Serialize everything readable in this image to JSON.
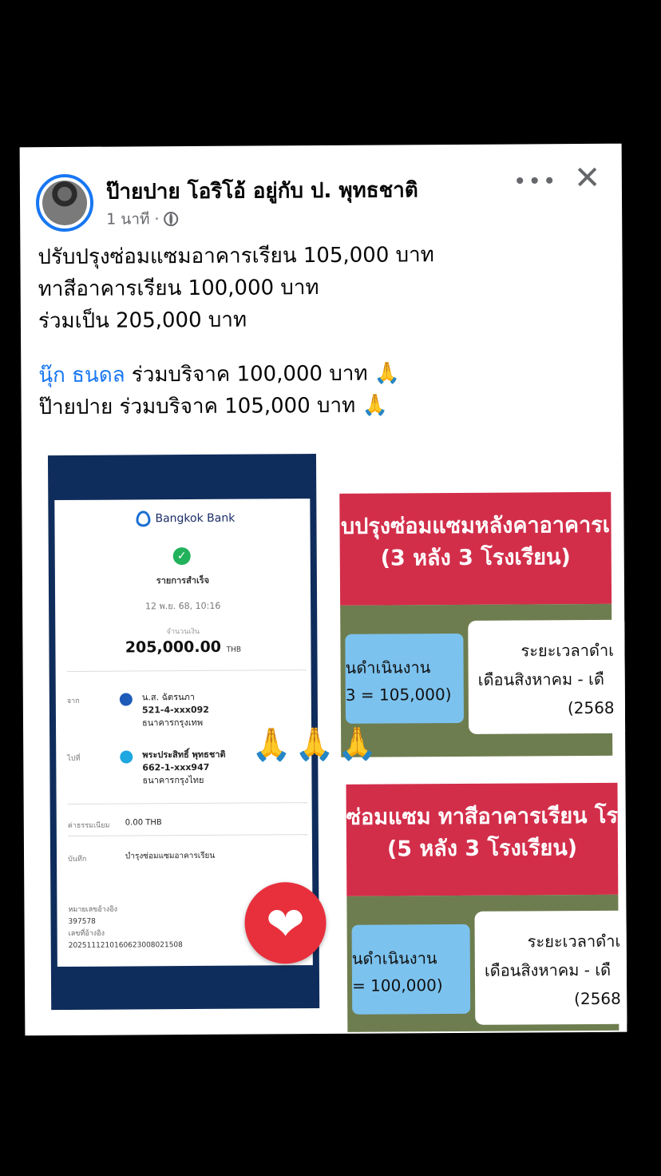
{
  "post": {
    "author": "ป๊ายปาย โอริโอ้ อยู่กับ ป. พุทธชาติ",
    "time": "1 นาที",
    "more_icon": "•••",
    "close_icon": "✕",
    "lines": [
      "ปรับปรุงซ่อมแซมอาคารเรียน 105,000 บาท",
      "ทาสีอาคารเรียน  100,000 บาท",
      "ร่วมเป็น 205,000 บาท"
    ],
    "mention": "นุ๊ก ธนดล",
    "donate1_text": " ร่วมบริจาค 100,000 บาท ",
    "donate2_text": "ป๊ายปาย ร่วมบริจาค 105,000 บาท ",
    "pray_emoji": "🙏"
  },
  "receipt": {
    "bank": "Bangkok Bank",
    "status": "รายการสำเร็จ",
    "datetime": "12 พ.ย. 68, 10:16",
    "amount_label": "จำนวนเงิน",
    "amount": "205,000.00",
    "currency": "THB",
    "from_label": "จาก",
    "from_name": "น.ส. ฉัตรนภา",
    "from_account": "521-4-xxx092",
    "from_bank": "ธนาคารกรุงเทพ",
    "to_label": "ไปที่",
    "to_name": "พระประสิทธิ์ พุทธชาติ",
    "to_account": "662-1-xxx947",
    "to_bank": "ธนาคารกรุงไทย",
    "fee_label": "ค่าธรรมเนียม",
    "fee": "0.00 THB",
    "note_label": "บันทึก",
    "note": "บำรุงซ่อมแซมอาคารเรียน",
    "ref_label": "หมายเลขอ้างอิง",
    "ref": "397578",
    "ref2_label": "เลขที่อ้างอิง",
    "ref2": "2025111210160623008021508"
  },
  "reactions": {
    "heart_icon": "❤",
    "hands": "🙏🙏🙏"
  },
  "panels": [
    {
      "title1": "บปรุงซ่อมแซมหลังคาอาคารเ",
      "title2": "(3 หลัง 3 โรงเรียน)",
      "budget1": "นดำเนินงาน",
      "budget2": "3 = 105,000)",
      "period_title": "ระยะเวลาดำเ",
      "period_months": "เดือนสิงหาคม - เดื",
      "period_year": "(2568"
    },
    {
      "title1": "ซ่อมแซม ทาสีอาคารเรียน โร",
      "title2": "(5 หลัง 3 โรงเรียน)",
      "budget1": "นดำเนินงาน",
      "budget2": "= 100,000)",
      "period_title": "ระยะเวลาดำเ",
      "period_months": "เดือนสิงหาคม - เดื",
      "period_year": "(2568"
    }
  ]
}
